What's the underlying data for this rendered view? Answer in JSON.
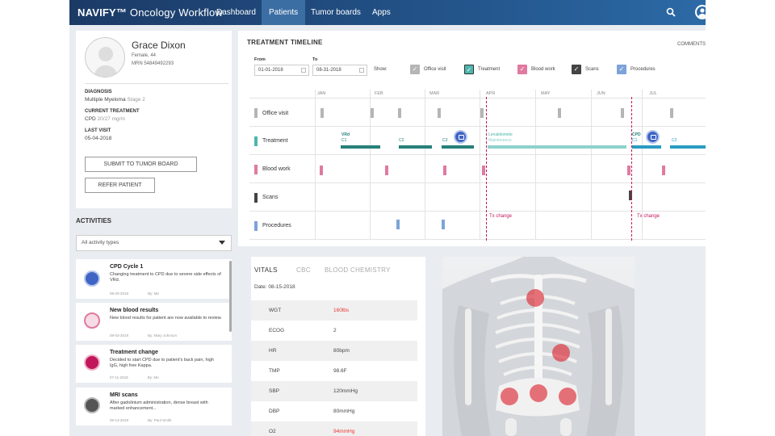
{
  "nav": {
    "brand": "NAVIFY™ Oncology Workflow",
    "tabs": [
      "Dashboard",
      "Patients",
      "Tumor boards",
      "Apps"
    ],
    "active_tab": "Patients"
  },
  "patient": {
    "name": "Grace Dixon",
    "sex_age": "Female, 44",
    "mrn": "MRN 54849492293",
    "diagnosis_label": "DIAGNOSIS",
    "diagnosis": "Multiple Myeloma",
    "diagnosis_stage": "Stage 2",
    "treatment_label": "CURRENT TREATMENT",
    "treatment": "CPD",
    "treatment_dose": "20/27 mg/m",
    "last_visit_label": "LAST VISIT",
    "last_visit": "05-04-2018",
    "submit_button": "SUBMIT TO TUMOR BOARD",
    "refer_button": "REFER PATIENT"
  },
  "activities": {
    "title": "ACTIVITIES",
    "filter": "All activity types",
    "items": [
      {
        "title": "CPD Cycle 1",
        "desc": "Changing treatment to CPD due to severe side effects of VRd.",
        "date": "08-20-2018",
        "by": "By: Me",
        "icon": "chat-icon",
        "color": "#3f64c4"
      },
      {
        "title": "New blood results",
        "desc": "New blood results for patient are now available to review.",
        "date": "08-03-2018",
        "by": "By: Mary Johnson",
        "icon": "blood-drop-icon",
        "color": "#e07aa0"
      },
      {
        "title": "Treatment change",
        "desc": "Decided to start CPD due to patient's back pain, high IgG, high free Kappa.",
        "date": "07-11-2018",
        "by": "By: Me",
        "icon": "clipboard-icon",
        "color": "#c2185b"
      },
      {
        "title": "MRI scans",
        "desc": "After gadolinium administration, dense breast with marked enhancement...",
        "date": "06-13-2018",
        "by": "By: Paul Smith",
        "icon": "scan-icon",
        "color": "#555555"
      }
    ]
  },
  "timeline": {
    "title": "TREATMENT TIMELINE",
    "comments": "COMMENTS",
    "from_label": "From",
    "from_value": "01-01-2018",
    "to_label": "To",
    "to_value": "08-31-2018",
    "show_label": "Show:",
    "filters": [
      {
        "label": "Office visit",
        "color": "#b5b5b5",
        "checked": true
      },
      {
        "label": "Treatment",
        "color": "#4db6ac",
        "checked": true
      },
      {
        "label": "Blood work",
        "color": "#e07aa0",
        "checked": true
      },
      {
        "label": "Scans",
        "color": "#444444",
        "checked": true
      },
      {
        "label": "Procedures",
        "color": "#7ea3d8",
        "checked": true
      }
    ],
    "months": [
      "JAN",
      "FEB",
      "MAR",
      "APR",
      "MAY",
      "JUN",
      "JUL"
    ],
    "rows": [
      "Office visit",
      "Treatment",
      "Blood work",
      "Scans",
      "Procedures"
    ],
    "treatment_labels": [
      "VRd",
      "C1",
      "C2",
      "C3",
      "Lenalidomide",
      "Maintenance",
      "CPD",
      "C1",
      "C2"
    ],
    "tx_change": "Tx change"
  },
  "vitals": {
    "tabs": [
      "VITALS",
      "CBC",
      "BLOOD CHEMISTRY"
    ],
    "date": "Date: 08-15-2018",
    "rows": [
      {
        "key": "WGT",
        "value": "160lbs",
        "alert": true
      },
      {
        "key": "ECOG",
        "value": "2",
        "alert": false
      },
      {
        "key": "HR",
        "value": "80bpm",
        "alert": false
      },
      {
        "key": "TMP",
        "value": "98.6F",
        "alert": false
      },
      {
        "key": "SBP",
        "value": "120mmHg",
        "alert": false
      },
      {
        "key": "DBP",
        "value": "80mmHg",
        "alert": false
      },
      {
        "key": "O2",
        "value": "94mmHg",
        "alert": true
      }
    ],
    "alert_color": "#e53935"
  }
}
